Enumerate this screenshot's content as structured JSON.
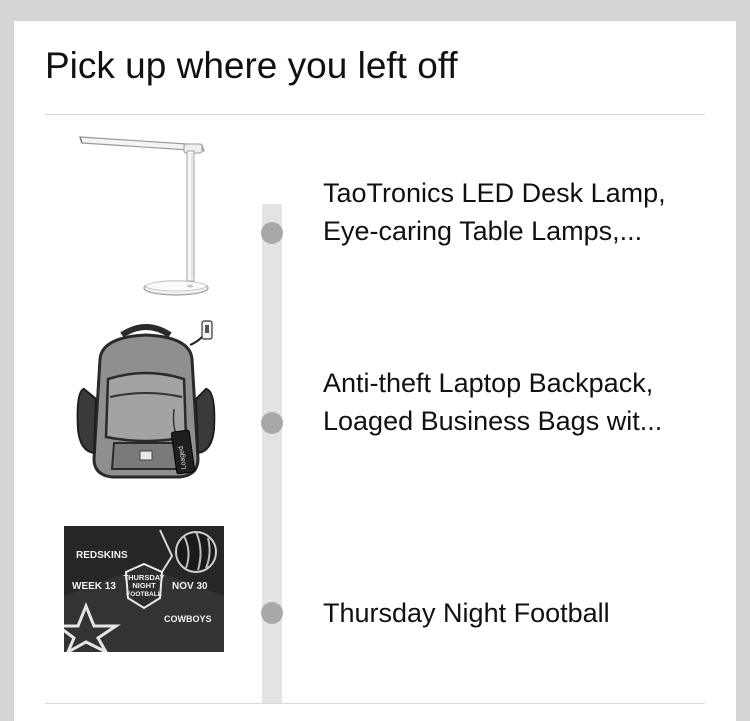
{
  "card": {
    "title": "Pick up where you left off"
  },
  "items": [
    {
      "thumb_icon": "desk-lamp-image",
      "title_line1": "TaoTronics LED Desk Lamp,",
      "title_line2": "Eye-caring Table Lamps,..."
    },
    {
      "thumb_icon": "laptop-backpack-image",
      "title_line1": "Anti-theft Laptop Backpack,",
      "title_line2": "Loaged Business Bags wit...",
      "tag_text": "Loaged"
    },
    {
      "thumb_icon": "thursday-night-football-image",
      "title_line1": "Thursday Night Football",
      "poster": {
        "team1": "REDSKINS",
        "week": "WEEK 13",
        "badge_line1": "THURSDAY",
        "badge_line2": "NIGHT",
        "badge_line3": "FOOTBALL",
        "date": "NOV 30",
        "team2": "COWBOYS"
      }
    }
  ],
  "colors": {
    "page_background": "#d5d5d5",
    "card_background": "#ffffff",
    "timeline_track": "#e3e3e3",
    "timeline_dot": "#a8a8a8",
    "divider": "#d9d9d9",
    "text": "#111111"
  }
}
